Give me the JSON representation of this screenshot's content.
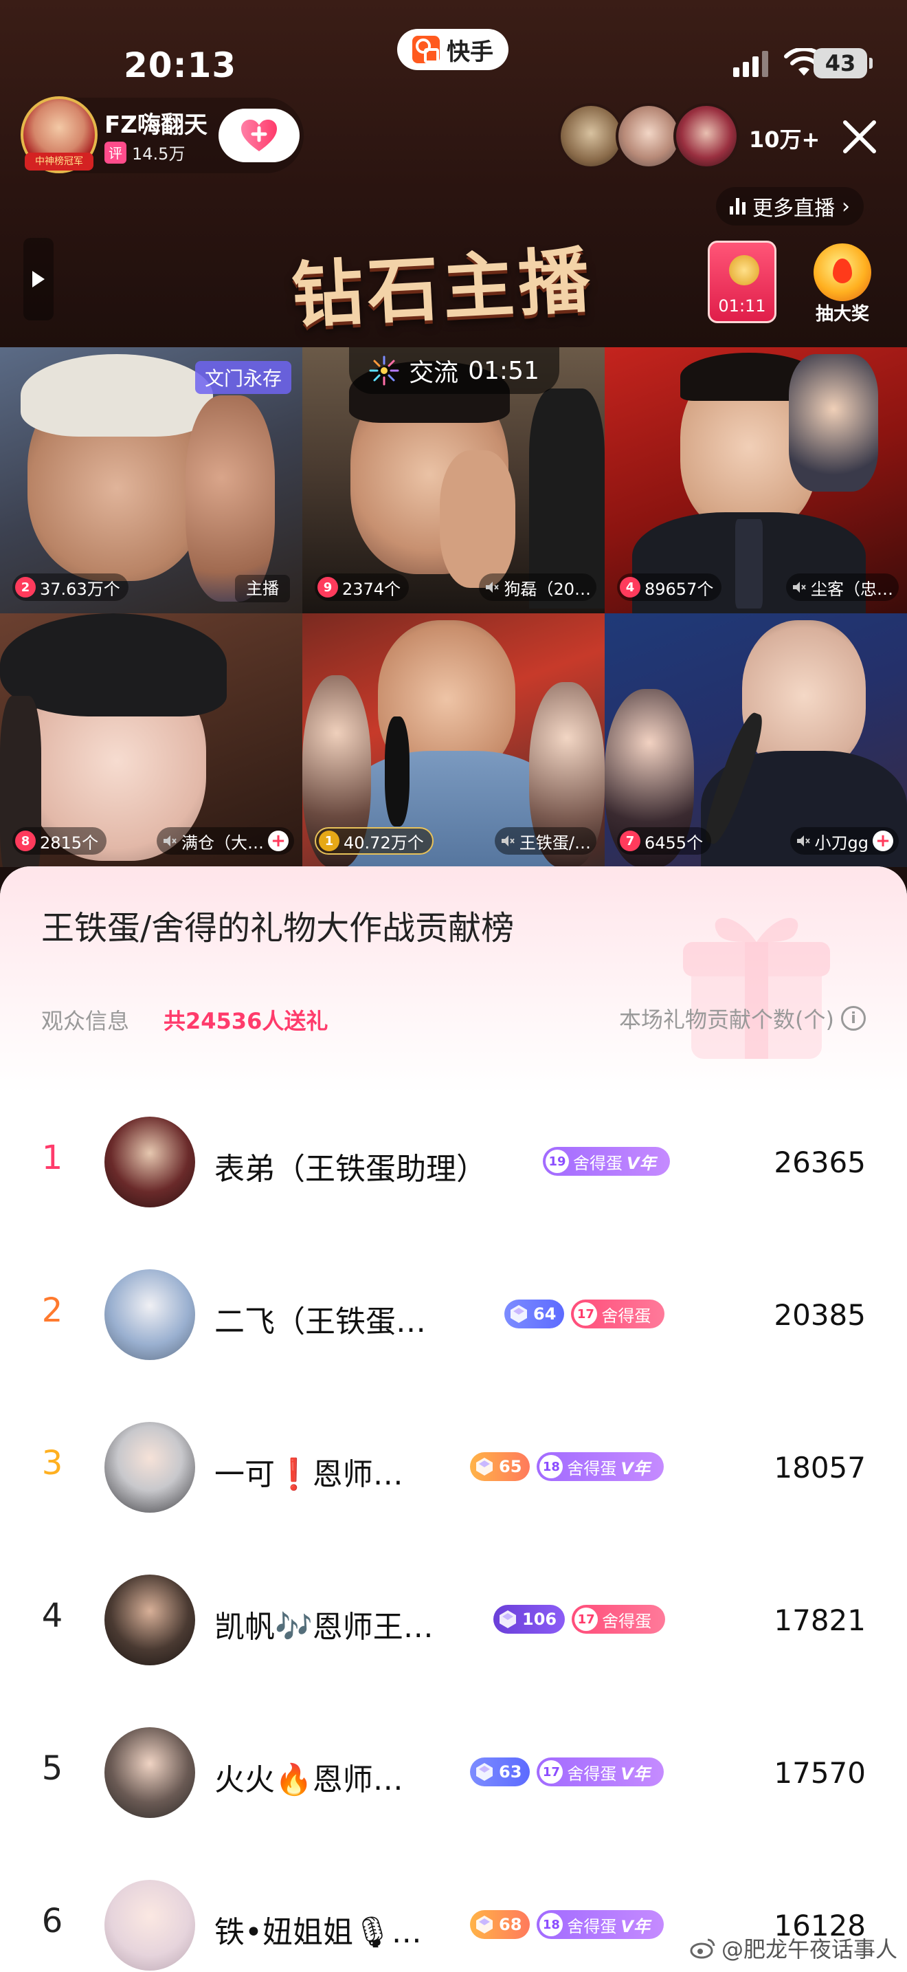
{
  "status_bar": {
    "time": "20:13",
    "app_name": "快手",
    "battery": "43"
  },
  "host": {
    "name": "FZ嗨翻天",
    "rating_badge": "评",
    "rating": "14.5万",
    "avatar_tag": "中神榜冠军"
  },
  "viewers": {
    "count": "10万+"
  },
  "more_live": {
    "label": "更多直播"
  },
  "banner": {
    "title": "钻石主播"
  },
  "red_envelope": {
    "timer": "01:11"
  },
  "lottery": {
    "label": "抽大奖"
  },
  "battle": {
    "label": "交流",
    "time": "01:51"
  },
  "tiles": [
    {
      "badge": "文门永存",
      "rank": "2",
      "value": "37.63万个",
      "name": "主播",
      "muted": false
    },
    {
      "badge": "",
      "rank": "9",
      "value": "2374个",
      "name": "狗磊（20…",
      "muted": true
    },
    {
      "badge": "",
      "rank": "4",
      "value": "89657个",
      "name": "尘客（忠…",
      "muted": true
    },
    {
      "badge": "",
      "rank": "8",
      "value": "2815个",
      "name": "满仓（大…",
      "muted": true
    },
    {
      "badge": "",
      "rank": "1",
      "value": "40.72万个",
      "name": "王铁蛋/…",
      "muted": true
    },
    {
      "badge": "",
      "rank": "7",
      "value": "6455个",
      "name": "小刀gg",
      "muted": true
    }
  ],
  "sheet": {
    "title": "王铁蛋/舍得的礼物大作战贡献榜",
    "audience_label": "观众信息",
    "sender_count": "共24536人送礼",
    "column_label": "本场礼物贡献个数(个)",
    "info_icon": "i"
  },
  "ranking": [
    {
      "pos": "1",
      "name": "表弟（王铁蛋助理）",
      "level": "",
      "fan_level": "19",
      "fan_name": "舍得蛋",
      "fan_vip": "V年",
      "fan_style": "purple",
      "score": "26365",
      "pos_color": "#ff3b6b"
    },
    {
      "pos": "2",
      "name": "二飞（王铁蛋…",
      "level": "64",
      "level_style": "blue",
      "fan_level": "17",
      "fan_name": "舍得蛋",
      "fan_vip": "",
      "fan_style": "red",
      "score": "20385",
      "pos_color": "#ff7a2e"
    },
    {
      "pos": "3",
      "name": "一可❗恩师…",
      "level": "65",
      "level_style": "orange",
      "fan_level": "18",
      "fan_name": "舍得蛋",
      "fan_vip": "V年",
      "fan_style": "purple",
      "score": "18057",
      "pos_color": "#ffb020"
    },
    {
      "pos": "4",
      "name": "凯帆🎶恩师王…",
      "level": "106",
      "level_style": "purple",
      "fan_level": "17",
      "fan_name": "舍得蛋",
      "fan_vip": "",
      "fan_style": "red",
      "score": "17821",
      "pos_color": "#222222"
    },
    {
      "pos": "5",
      "name": "火火🔥恩师…",
      "level": "63",
      "level_style": "blue",
      "fan_level": "17",
      "fan_name": "舍得蛋",
      "fan_vip": "V年",
      "fan_style": "purple",
      "score": "17570",
      "pos_color": "#222222"
    },
    {
      "pos": "6",
      "name": "铁•妞姐姐🎙…",
      "level": "68",
      "level_style": "orange",
      "fan_level": "18",
      "fan_name": "舍得蛋",
      "fan_vip": "V年",
      "fan_style": "purple",
      "score": "16128",
      "pos_color": "#222222"
    }
  ],
  "watermark": "@肥龙午夜话事人",
  "colors": {
    "accent": "#ff3b6b",
    "sheet_bg": "#ffffff",
    "top_bg": "#2a1410"
  }
}
